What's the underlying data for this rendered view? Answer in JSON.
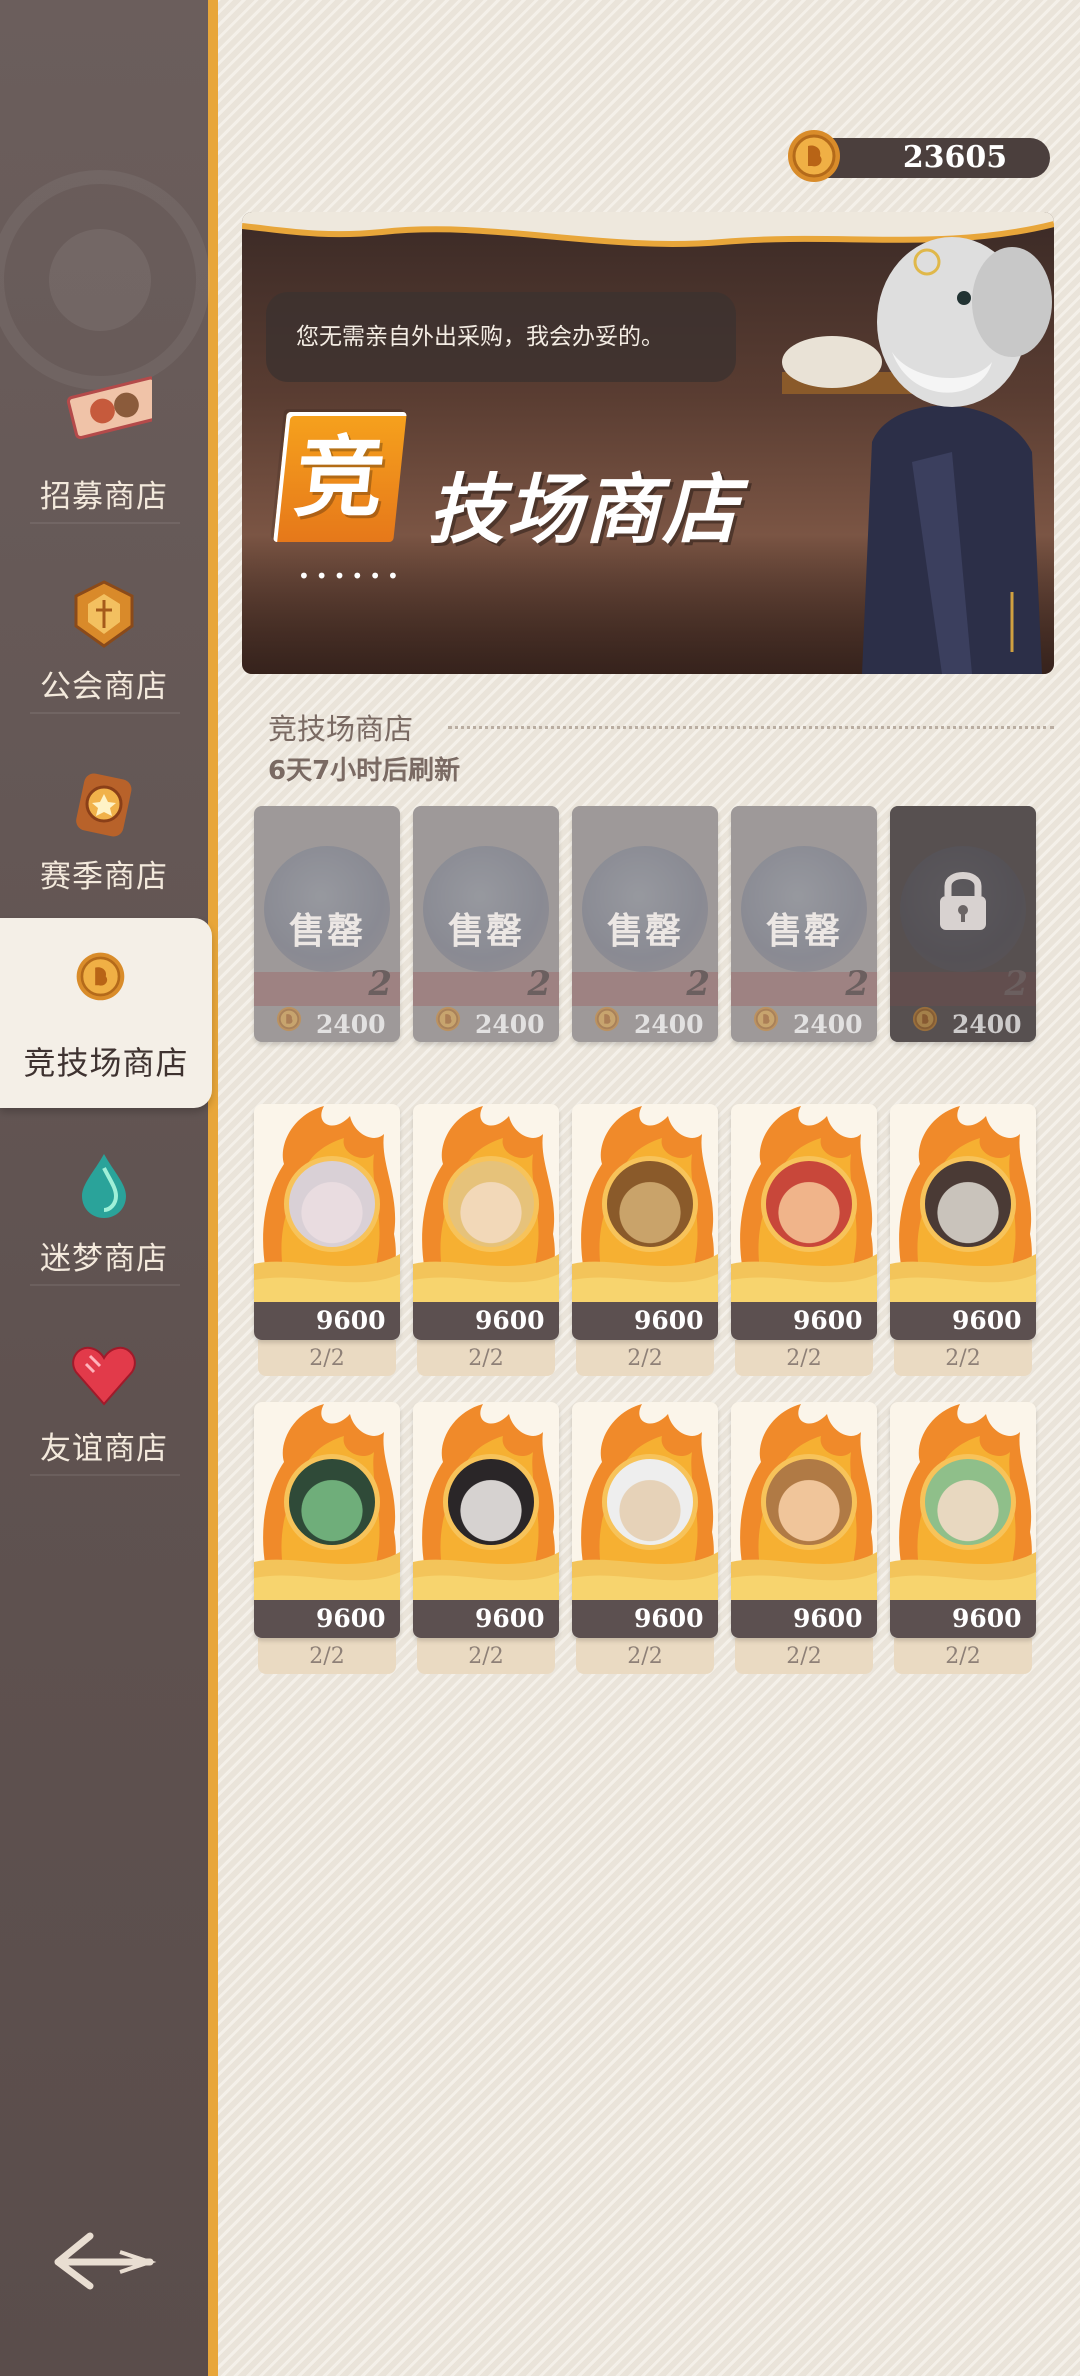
{
  "sidebar": {
    "items": [
      {
        "label": "招募商店",
        "icon": "recruit-ticket-icon"
      },
      {
        "label": "公会商店",
        "icon": "guild-emblem-icon"
      },
      {
        "label": "赛季商店",
        "icon": "season-medal-icon"
      },
      {
        "label": "竞技场商店",
        "icon": "arena-coin-icon",
        "active": true
      },
      {
        "label": "迷梦商店",
        "icon": "dream-drop-icon"
      },
      {
        "label": "友谊商店",
        "icon": "heart-gem-icon"
      }
    ],
    "back_icon": "back-arrow-icon"
  },
  "currency": {
    "amount": "23605",
    "icon": "arena-coin-icon"
  },
  "banner": {
    "speech": "您无需亲自外出采购，我会办妥的。",
    "badge_char": "竞",
    "title_rest": "技场商店",
    "dots": "••••••"
  },
  "section": {
    "title": "竞技场商店",
    "refresh": "6天7小时后刷新"
  },
  "sold_row": [
    {
      "status": "售罄",
      "num": "2",
      "price": "2400",
      "locked": false
    },
    {
      "status": "售罄",
      "num": "2",
      "price": "2400",
      "locked": false
    },
    {
      "status": "售罄",
      "num": "2",
      "price": "2400",
      "locked": false
    },
    {
      "status": "售罄",
      "num": "2",
      "price": "2400",
      "locked": false
    },
    {
      "status": "",
      "num": "2",
      "price": "2400",
      "locked": true,
      "icon": "lock-icon"
    }
  ],
  "hero_rows": [
    [
      {
        "price": "9600",
        "stock": "2/2",
        "portrait": "#e9dce0",
        "hair": "#d9d0d6"
      },
      {
        "price": "9600",
        "stock": "2/2",
        "portrait": "#f2d8b8",
        "hair": "#e6c27a"
      },
      {
        "price": "9600",
        "stock": "2/2",
        "portrait": "#c9a36a",
        "hair": "#8a5a2a"
      },
      {
        "price": "9600",
        "stock": "2/2",
        "portrait": "#f0b48a",
        "hair": "#c8473a"
      },
      {
        "price": "9600",
        "stock": "2/2",
        "portrait": "#c9c3bb",
        "hair": "#4a3a35"
      }
    ],
    [
      {
        "price": "9600",
        "stock": "2/2",
        "portrait": "#6fae7a",
        "hair": "#2f4a38"
      },
      {
        "price": "9600",
        "stock": "2/2",
        "portrait": "#d6d2d0",
        "hair": "#2a2628"
      },
      {
        "price": "9600",
        "stock": "2/2",
        "portrait": "#e6d2b8",
        "hair": "#eeeeee"
      },
      {
        "price": "9600",
        "stock": "2/2",
        "portrait": "#f0c59a",
        "hair": "#b07a45"
      },
      {
        "price": "9600",
        "stock": "2/2",
        "portrait": "#e8d8c0",
        "hair": "#8fbf8a"
      }
    ]
  ]
}
